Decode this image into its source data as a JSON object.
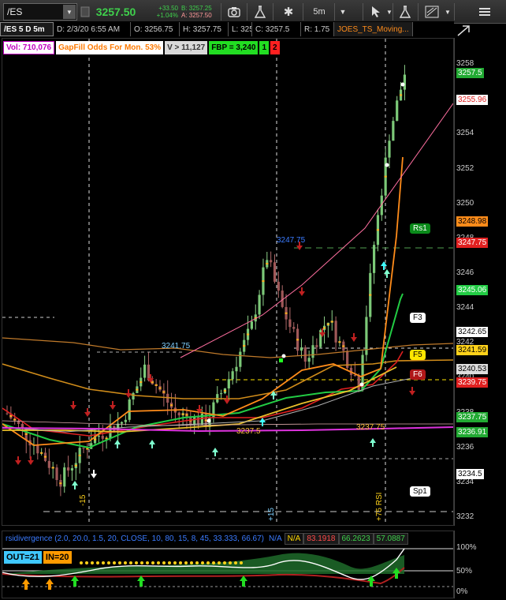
{
  "toolbar": {
    "symbol": "/ES",
    "last_price": "3257.50",
    "net_change": "+33.50",
    "pct_change": "+1.04%",
    "bid": "B: 3257.25",
    "ask": "A: 3257.50",
    "interval": "5m",
    "icons": [
      "dropdown-icon",
      "camera-icon",
      "flask-icon",
      "gear-icon",
      "cursor-icon",
      "flask-icon",
      "drawing-tools-icon"
    ]
  },
  "infobar": {
    "symbol_period": "/ES 5 D 5m",
    "date": "D: 2/3/20 6:55 AM",
    "open": "O: 3256.75",
    "high": "H: 3257.75",
    "low": "L: 3256",
    "close": "C: 3257.5",
    "range": "R: 1.75",
    "study": "JOES_TS_Moving...",
    "side_icon": "expand-icon"
  },
  "chips": {
    "vol": "Vol: 710,076",
    "gapfill": "GapFill Odds For Mon. 53%",
    "v": "V > 11,127",
    "fbp": "FBP = 3,240",
    "one": "1",
    "two": "2"
  },
  "axis": {
    "ticks": [
      "3258",
      "3256",
      "3254",
      "3252",
      "3250",
      "3248",
      "3246",
      "3244",
      "3242",
      "3240",
      "3238",
      "3236",
      "3234",
      "3232"
    ],
    "tick_values": [
      3258,
      3256,
      3254,
      3252,
      3250,
      3248,
      3246,
      3244,
      3242,
      3240,
      3238,
      3236,
      3234,
      3232
    ],
    "price_labels": [
      {
        "text": "3257.5",
        "value": 3257.5,
        "bg": "#22aa33",
        "fg": "#ffffff"
      },
      {
        "text": "3255.96",
        "value": 3255.96,
        "bg": "#ffffff",
        "fg": "#e02020"
      },
      {
        "text": "3248.98",
        "value": 3248.98,
        "bg": "#ff8c1a",
        "fg": "#000000"
      },
      {
        "text": "3247.75",
        "value": 3247.75,
        "bg": "#e02020",
        "fg": "#ffffff"
      },
      {
        "text": "3245.06",
        "value": 3245.06,
        "bg": "#22cc44",
        "fg": "#ffffff"
      },
      {
        "text": "3242.65",
        "value": 3242.65,
        "bg": "#ffffff",
        "fg": "#000000"
      },
      {
        "text": "3241.59",
        "value": 3241.59,
        "bg": "#ffd21a",
        "fg": "#000000"
      },
      {
        "text": "3240.53",
        "value": 3240.53,
        "bg": "#dddddd",
        "fg": "#000000"
      },
      {
        "text": "3239.75",
        "value": 3239.75,
        "bg": "#e02020",
        "fg": "#ffffff"
      },
      {
        "text": "3237.75",
        "value": 3237.75,
        "bg": "#22aa33",
        "fg": "#ffffff"
      },
      {
        "text": "3236.91",
        "value": 3236.91,
        "bg": "#22aa33",
        "fg": "#ffffff"
      },
      {
        "text": "3234.5",
        "value": 3234.5,
        "bg": "#ffffff",
        "fg": "#000000"
      }
    ]
  },
  "annotations": {
    "hi_label": "3247.75",
    "mid_label": "3241.75",
    "low1_label": "3237.5",
    "low2_label": "3237.75",
    "vline_left": "-15",
    "vline_mid": "+15",
    "vline_right": "+75 RSI",
    "pivots": [
      {
        "text": "Rs1",
        "value": 3247.75
      },
      {
        "text": "F3",
        "value": 3242.65
      },
      {
        "text": "F5",
        "value": 3240.53
      },
      {
        "text": "F6",
        "value": 3239.4
      },
      {
        "text": "Sp1",
        "value": 3232.7
      }
    ]
  },
  "lower": {
    "title": "rsidivergence (2.0, 20.0, 1.5, 20, CLOSE, 10, 80, 15, 8, 45, 33.333, 66.67)",
    "na1": "N/A",
    "na2": "N/A",
    "val1": "83.1918",
    "val2": "66.2623",
    "val3": "57.0887",
    "out": "OUT=21",
    "in": "IN=20",
    "axis_ticks": [
      "100%",
      "50%",
      "0%"
    ]
  },
  "chart_data": {
    "type": "line",
    "x": [
      "bar 1",
      "bar 80"
    ],
    "y_range": [
      3231.5,
      3259.5
    ],
    "series": [
      {
        "name": "",
        "color": "#ff8c1a",
        "values": [
          3238.2,
          3248.98
        ]
      },
      {
        "name": "",
        "color": "#e02020",
        "values": [
          3239.3,
          3247.75
        ]
      },
      {
        "name": "",
        "color": "#22cc44",
        "values": [
          3237.0,
          3245.06
        ]
      },
      {
        "name": "",
        "color": "#ffd21a",
        "values": [
          3242.3,
          3241.59
        ]
      },
      {
        "name": "",
        "color": "#ff6fa0",
        "values": [
          3240.5,
          3255.96
        ]
      },
      {
        "name": "",
        "color": "#dd33dd",
        "values": [
          3237.2,
          3237.75
        ]
      }
    ]
  }
}
